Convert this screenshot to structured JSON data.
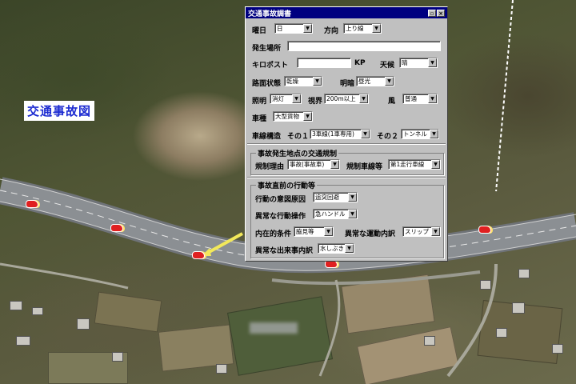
{
  "map": {
    "title": "交通事故図",
    "road_marks": [
      "158",
      "158",
      "158",
      "158"
    ]
  },
  "dialog": {
    "title": "交通事故調書",
    "weekday": {
      "label": "曜日",
      "value": "日"
    },
    "direction": {
      "label": "方向",
      "value": "上り線"
    },
    "location": {
      "label": "発生場所",
      "value": ""
    },
    "kilopost": {
      "label": "キロポスト",
      "value": "",
      "unit": "KP"
    },
    "weather": {
      "label": "天候",
      "value": "晴"
    },
    "road_surface": {
      "label": "路面状態",
      "value": "乾燥"
    },
    "brightness": {
      "label": "明暗",
      "value": "昼光"
    },
    "lighting": {
      "label": "照明",
      "value": "消灯"
    },
    "visibility": {
      "label": "視界",
      "value": "200m以上"
    },
    "wind": {
      "label": "風",
      "value": "普通"
    },
    "vehicle_type": {
      "label": "車種",
      "value": "大型貨物"
    },
    "lane_structure": {
      "label": "車線構造",
      "part1_label": "その１",
      "part1_value": "3車線(1車専用)",
      "part2_label": "その２",
      "part2_value": "トンネル"
    },
    "regulation_group": {
      "title": "事故発生地点の交通規制",
      "reason": {
        "label": "規制理由",
        "value": "事故(事故車)"
      },
      "lane": {
        "label": "規制車線等",
        "value": "第1走行車線"
      }
    },
    "behavior_group": {
      "title": "事故直前の行動等",
      "intent": {
        "label": "行動の意図原因",
        "value": "追突回避"
      },
      "abnormal_op": {
        "label": "異常な行動操作",
        "value": "急ハンドル"
      },
      "internal": {
        "label": "内在的条件",
        "value": "脇見等"
      },
      "motion": {
        "label": "異常な運動内訳",
        "value": "スリップ"
      },
      "event": {
        "label": "異常な出来事内訳",
        "value": "水しぶき"
      }
    }
  }
}
